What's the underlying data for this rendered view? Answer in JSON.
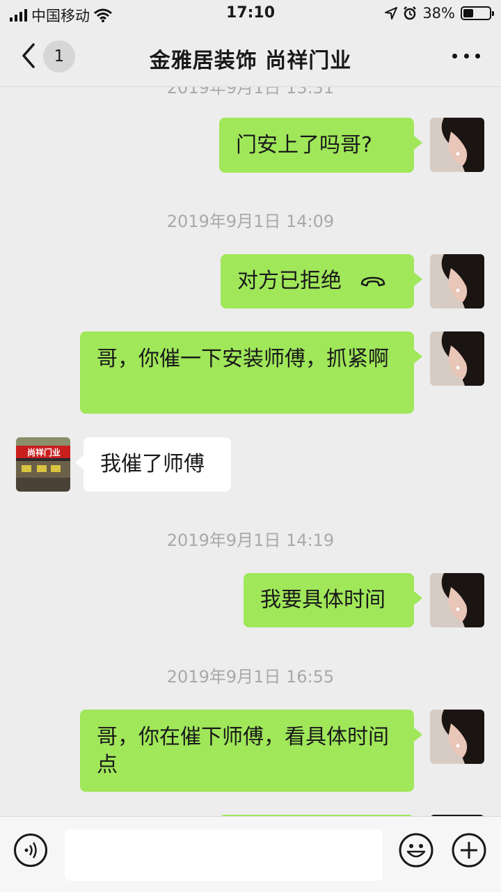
{
  "status": {
    "carrier": "中国移动",
    "time": "17:10",
    "battery": "38%",
    "battery_level": 0.38
  },
  "nav": {
    "back_count": "1",
    "title": "金雅居装饰 尚祥门业"
  },
  "chat": {
    "partial_timestamp": "2019年9月1日 13:31",
    "messages": [
      {
        "text": "门安上了吗哥?"
      },
      {
        "timestamp": "2019年9月1日 14:09"
      },
      {
        "text": "对方已拒绝",
        "icon": "hang-up-phone-icon"
      },
      {
        "text": "哥，你催一下安装师傅，抓紧啊"
      },
      {
        "text": "我催了师傅"
      },
      {
        "timestamp": "2019年9月1日 14:19"
      },
      {
        "text": "我要具体时间"
      },
      {
        "timestamp": "2019年9月1日 16:55"
      },
      {
        "text": "哥，你在催下师傅，看具体时间点"
      }
    ],
    "shop_avatar_text": "尚祥门业"
  },
  "input": {
    "value": ""
  },
  "icons": [
    "signal-icon",
    "wifi-icon",
    "location-icon",
    "alarm-icon",
    "battery-icon",
    "back-arrow-icon",
    "more-icon",
    "voice-icon",
    "emoji-icon",
    "plus-icon",
    "hang-up-phone-icon"
  ]
}
